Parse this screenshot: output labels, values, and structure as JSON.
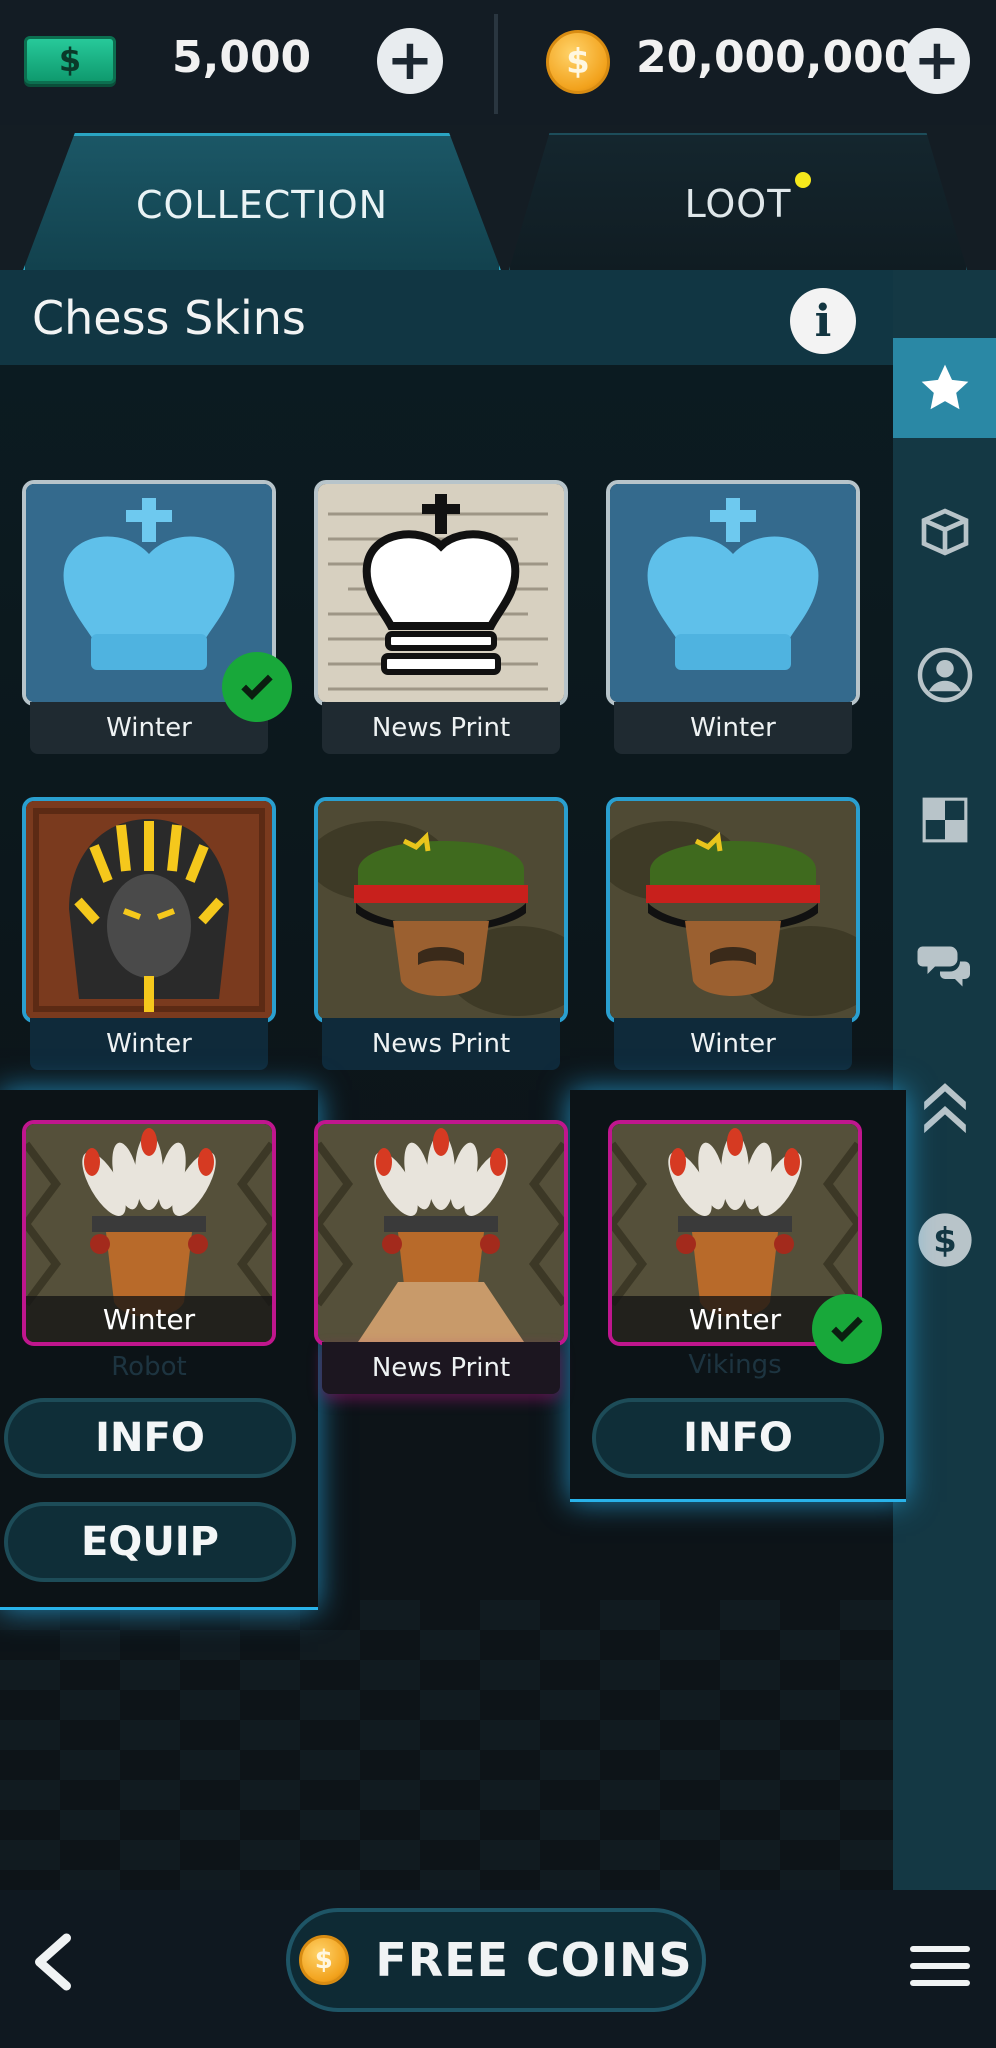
{
  "currency": {
    "cash_value": "5,000",
    "coin_value": "20,000,000",
    "cash_symbol": "$",
    "coin_symbol": "$",
    "plus": "+"
  },
  "tabs": [
    {
      "label": "COLLECTION",
      "active": true
    },
    {
      "label": "LOOT",
      "has_notification": true
    }
  ],
  "panel": {
    "title": "Chess Skins",
    "info_symbol": "i"
  },
  "sidebar": [
    "star-icon",
    "box-icon",
    "profile-icon",
    "board-icon",
    "chat-icon",
    "rank-chevrons-icon",
    "dollar-icon"
  ],
  "cards": [
    {
      "label": "Winter",
      "equipped": true
    },
    {
      "label": "News Print"
    },
    {
      "label": "Winter"
    },
    {
      "label": "Winter"
    },
    {
      "label": "News Print"
    },
    {
      "label": "Winter"
    },
    {
      "label": "Winter",
      "subtitle": "Robot"
    },
    {
      "label": "News Print"
    },
    {
      "label": "Winter",
      "subtitle": "Vikings",
      "equipped": true
    }
  ],
  "buttons": {
    "info": "INFO",
    "equip": "EQUIP",
    "free_coins": "FREE COINS"
  },
  "colors": {
    "accent": "#2a9fcf",
    "equipped_check": "#18a83a",
    "rarity_pink": "#c0168e",
    "coin": "#f2a21c",
    "cash": "#1fb889"
  }
}
